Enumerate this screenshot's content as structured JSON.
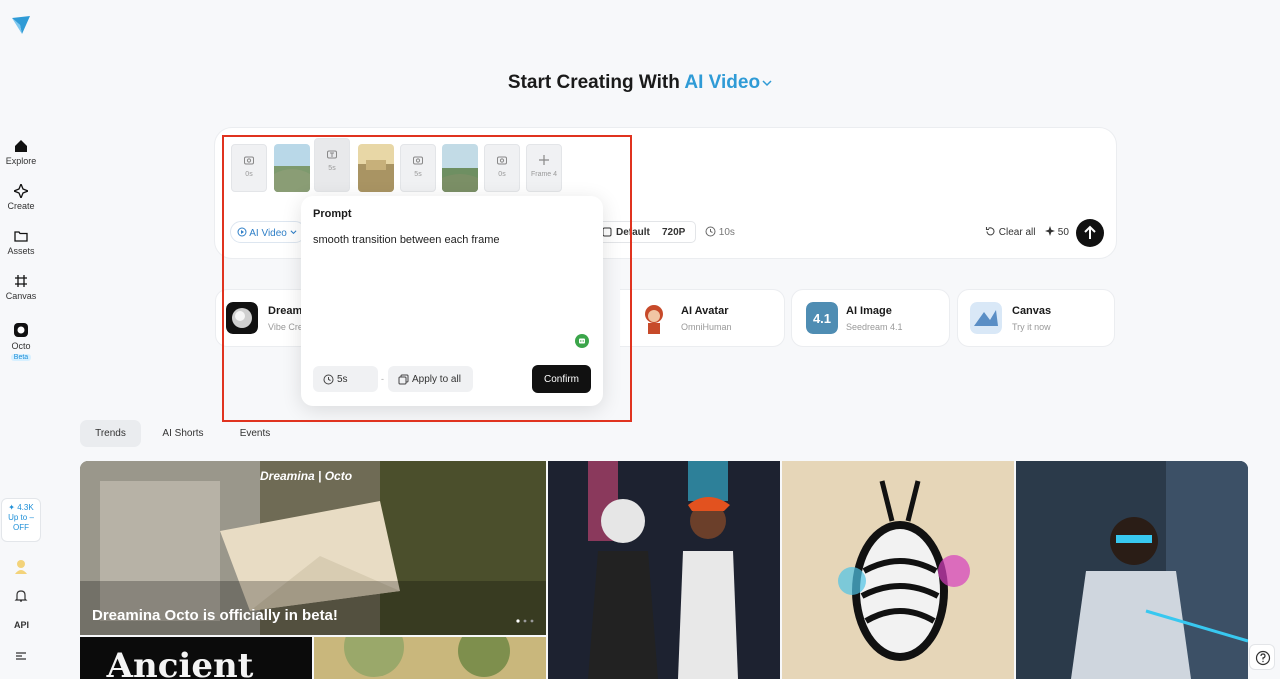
{
  "sidebar": {
    "items": [
      {
        "label": "Explore",
        "icon": "home-icon"
      },
      {
        "label": "Create",
        "icon": "sparkle-icon"
      },
      {
        "label": "Assets",
        "icon": "folder-icon"
      },
      {
        "label": "Canvas",
        "icon": "grid-icon"
      },
      {
        "label": "Octo",
        "icon": "octo-icon",
        "badge": "Beta"
      }
    ],
    "promo": {
      "count": "✦ 4.3K",
      "line1": "Up to –",
      "line2": "OFF"
    },
    "api_label": "API"
  },
  "header": {
    "title_prefix": "Start Creating With",
    "title_accent": "AI Video",
    "accent_color": "#2f9bd6"
  },
  "composer": {
    "frames": [
      {
        "type": "empty",
        "label": "0s"
      },
      {
        "type": "image"
      },
      {
        "type": "empty",
        "label": "5s"
      },
      {
        "type": "image"
      },
      {
        "type": "empty",
        "label": "5s"
      },
      {
        "type": "image"
      },
      {
        "type": "empty",
        "label": "0s"
      },
      {
        "type": "add",
        "label": "Frame 4"
      }
    ],
    "model": "AI Video",
    "aspect": "Default",
    "resolution": "720P",
    "duration": "10s",
    "clear_label": "Clear all",
    "credits": "50"
  },
  "popup": {
    "title": "Prompt",
    "text": "smooth transition between each frame",
    "duration": "5s",
    "separator": "-",
    "apply_label": "Apply to all",
    "confirm_label": "Confirm"
  },
  "features": [
    {
      "title": "Dreami",
      "subtitle": "Vibe Cre"
    },
    {
      "title": "AI Avatar",
      "subtitle": "OmniHuman"
    },
    {
      "title": "AI Image",
      "subtitle": "Seedream 4.1"
    },
    {
      "title": "Canvas",
      "subtitle": "Try it now"
    }
  ],
  "tabs": [
    "Trends",
    "AI Shorts",
    "Events"
  ],
  "gallery": {
    "hero_caption": "Dreamina Octo is officially in beta!",
    "hero_brand": "Dreamina | Octo"
  }
}
